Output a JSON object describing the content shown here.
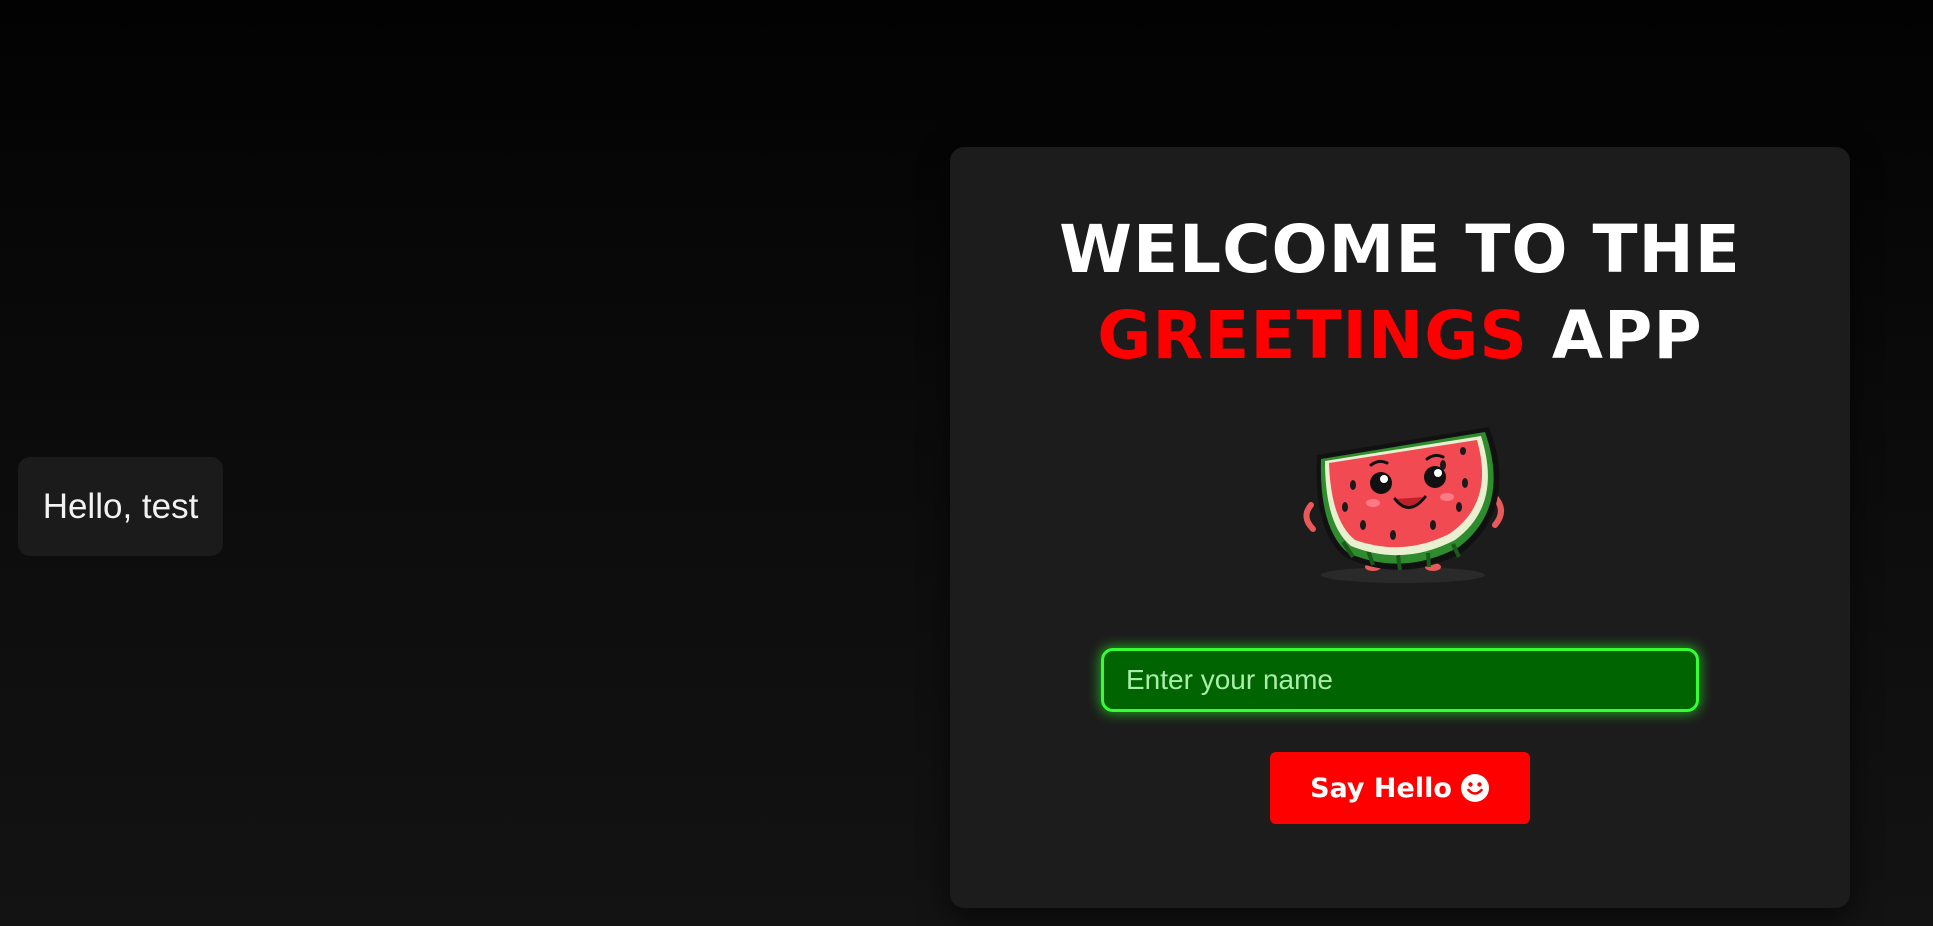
{
  "toast": {
    "message": "Hello, test"
  },
  "header": {
    "title_line1": "WELCOME TO THE",
    "title_accent": "GREETINGS",
    "title_suffix": "APP"
  },
  "mascot": {
    "icon": "watermelon-mascot-icon"
  },
  "form": {
    "name_placeholder": "Enter your name",
    "name_value": "",
    "button_label": "Say Hello",
    "button_icon": "smile-icon"
  },
  "colors": {
    "accent": "#ff0000",
    "input_bg": "#006400",
    "input_glow": "#33ff33",
    "card_bg": "#1c1c1c"
  }
}
